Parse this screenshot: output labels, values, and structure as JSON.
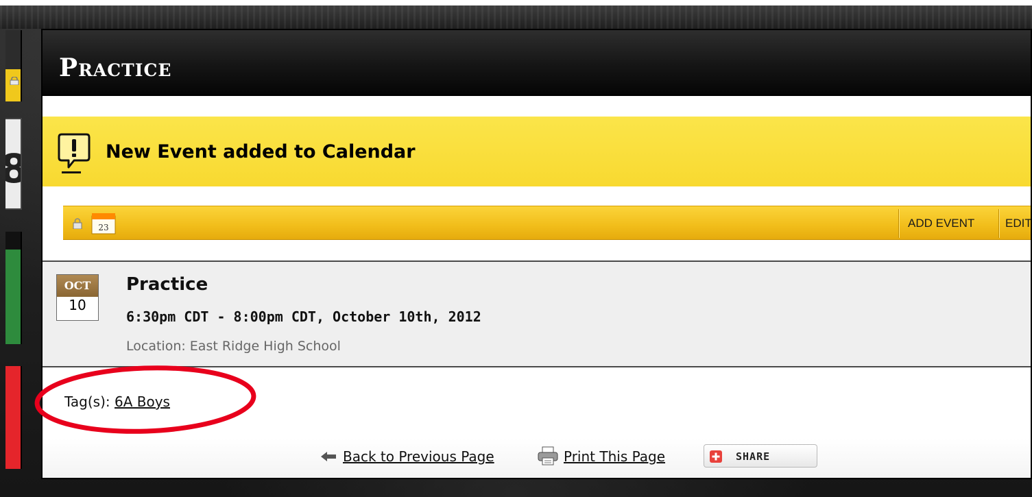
{
  "page": {
    "title": "Practice"
  },
  "notice": {
    "icon": "alert-speech-bubble-icon",
    "message": "New Event added to Calendar"
  },
  "toolbar": {
    "lock_icon": "lock-icon",
    "calendar_icon": "calendar-icon",
    "calendar_icon_day": "23",
    "buttons": [
      {
        "label": "ADD EVENT"
      },
      {
        "label": "EDIT"
      }
    ]
  },
  "event": {
    "month": "OCT",
    "day": "10",
    "title": "Practice",
    "time": "6:30pm CDT - 8:00pm CDT, October 10th, 2012",
    "location": "Location: East Ridge High School"
  },
  "tags": {
    "label": "Tag(s):",
    "items": [
      {
        "label": "6A Boys"
      }
    ]
  },
  "footer": {
    "back_label": "Back to Previous Page",
    "print_label": "Print This Page",
    "share_label": "SHARE"
  },
  "colors": {
    "notice_yellow": "#f8d930",
    "toolbar_gold": "#f1bd1a",
    "annotation_red": "#e8001c",
    "date_month_bg": "#8a6633"
  }
}
